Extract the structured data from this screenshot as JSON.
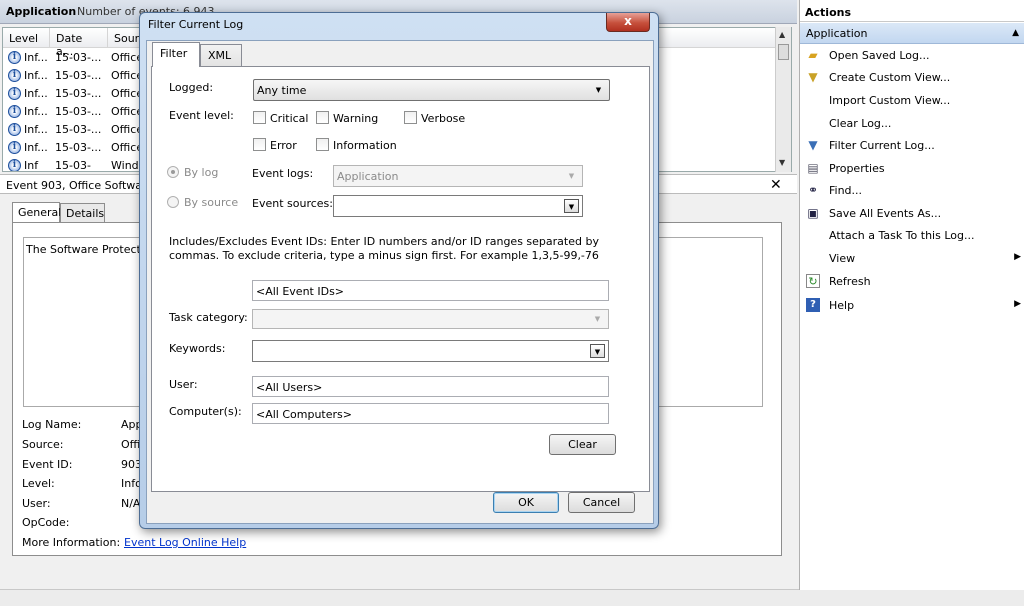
{
  "main": {
    "title": "Application",
    "event_count": "Number of events: 6,943",
    "columns": [
      "Level",
      "Date a...",
      "Sourc"
    ],
    "rows": [
      {
        "level": "Inf...",
        "date": "15-03-...",
        "source": "Office"
      },
      {
        "level": "Inf...",
        "date": "15-03-...",
        "source": "Office"
      },
      {
        "level": "Inf...",
        "date": "15-03-...",
        "source": "Office"
      },
      {
        "level": "Inf...",
        "date": "15-03-...",
        "source": "Office"
      },
      {
        "level": "Inf...",
        "date": "15-03-...",
        "source": "Office"
      },
      {
        "level": "Inf...",
        "date": "15-03-...",
        "source": "Office"
      },
      {
        "level": "Inf",
        "date": "15-03-",
        "source": "Windo"
      }
    ],
    "detail_title": "Event 903, Office Software I",
    "detail_tabs": [
      "General",
      "Details"
    ],
    "detail_text": "The Software Protection",
    "fields": [
      {
        "label": "Log Name:",
        "value": "Appl"
      },
      {
        "label": "Source:",
        "value": "Offi"
      },
      {
        "label": "Event ID:",
        "value": "903"
      },
      {
        "label": "Level:",
        "value": "Info"
      },
      {
        "label": "User:",
        "value": "N/A"
      },
      {
        "label": "OpCode:",
        "value": ""
      }
    ],
    "more_info_label": "More Information:",
    "more_info_link": "Event Log Online Help"
  },
  "actions": {
    "title": "Actions",
    "section": "Application",
    "items": [
      {
        "label": "Open Saved Log...",
        "icon": "folder-open-icon",
        "glyph": "📂"
      },
      {
        "label": "Create Custom View...",
        "icon": "filter-icon",
        "glyph": "▼"
      },
      {
        "label": "Import Custom View...",
        "icon": "",
        "glyph": ""
      },
      {
        "label": "Clear Log...",
        "icon": "",
        "glyph": ""
      },
      {
        "label": "Filter Current Log...",
        "icon": "filter-icon",
        "glyph": "▼"
      },
      {
        "label": "Properties",
        "icon": "properties-icon",
        "glyph": "▤"
      },
      {
        "label": "Find...",
        "icon": "binoculars-icon",
        "glyph": "⚭"
      },
      {
        "label": "Save All Events As...",
        "icon": "save-icon",
        "glyph": "▣"
      },
      {
        "label": "Attach a Task To this Log...",
        "icon": "",
        "glyph": ""
      },
      {
        "label": "View",
        "icon": "",
        "glyph": "",
        "submenu": true
      },
      {
        "label": "Refresh",
        "icon": "refresh-icon",
        "glyph": "↻"
      },
      {
        "label": "Help",
        "icon": "help-icon",
        "glyph": "?",
        "submenu": true
      }
    ]
  },
  "dialog": {
    "title": "Filter Current Log",
    "close": "x",
    "tabs": [
      "Filter",
      "XML"
    ],
    "logged_label": "Logged:",
    "logged_value": "Any time",
    "event_level_label": "Event level:",
    "levels": {
      "critical": "Critical",
      "warning": "Warning",
      "verbose": "Verbose",
      "error": "Error",
      "information": "Information"
    },
    "by_log": "By log",
    "by_source": "By source",
    "event_logs_label": "Event logs:",
    "event_logs_value": "Application",
    "event_sources_label": "Event sources:",
    "event_sources_value": "",
    "ids_help": "Includes/Excludes Event IDs: Enter ID numbers and/or ID ranges separated by commas. To exclude criteria, type a minus sign first. For example 1,3,5-99,-76",
    "event_ids_value": "<All Event IDs>",
    "task_category_label": "Task category:",
    "keywords_label": "Keywords:",
    "user_label": "User:",
    "user_value": "<All Users>",
    "computer_label": "Computer(s):",
    "computer_value": "<All Computers>",
    "clear": "Clear",
    "ok": "OK",
    "cancel": "Cancel"
  }
}
